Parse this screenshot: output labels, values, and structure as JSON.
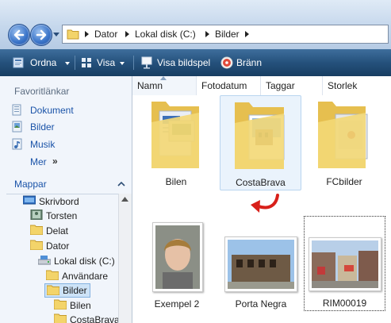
{
  "breadcrumb": [
    "Dator",
    "Lokal disk (C:)",
    "Bilder"
  ],
  "toolbar": {
    "organize": "Ordna",
    "view": "Visa",
    "slideshow": "Visa bildspel",
    "burn": "Bränn"
  },
  "sidebar": {
    "favorites_title": "Favoritlänkar",
    "favorites": [
      "Dokument",
      "Bilder",
      "Musik"
    ],
    "more": "Mer",
    "more_glyph": "»",
    "folders_title": "Mappar",
    "tree": [
      {
        "label": "Skrivbord"
      },
      {
        "label": "Torsten"
      },
      {
        "label": "Delat"
      },
      {
        "label": "Dator"
      },
      {
        "label": "Lokal disk (C:)"
      },
      {
        "label": "Användare"
      },
      {
        "label": "Bilder"
      },
      {
        "label": "Bilen"
      },
      {
        "label": "CostaBrava"
      }
    ]
  },
  "columns": [
    "Namn",
    "Fotodatum",
    "Taggar",
    "Storlek"
  ],
  "items": [
    {
      "name": "Bilen",
      "type": "folder"
    },
    {
      "name": "CostaBrava",
      "type": "folder"
    },
    {
      "name": "FCbilder",
      "type": "folder"
    },
    {
      "name": "Exempel 2",
      "type": "photo"
    },
    {
      "name": "Porta Negra",
      "type": "photo"
    },
    {
      "name": "RIM00019",
      "type": "photo"
    }
  ]
}
